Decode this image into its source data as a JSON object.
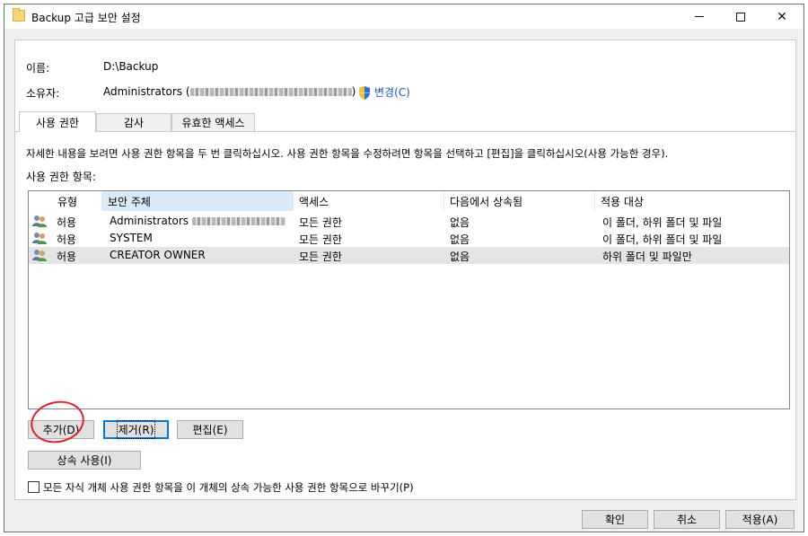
{
  "window": {
    "title": "Backup 고급 보안 설정"
  },
  "info": {
    "name_label": "이름:",
    "name_value": "D:\\Backup",
    "owner_label": "소유자:",
    "owner_value": "Administrators (",
    "owner_value_end": ")",
    "change_link": "변경(C)"
  },
  "tabs": [
    {
      "label": "사용 권한",
      "active": true
    },
    {
      "label": "감사",
      "active": false
    },
    {
      "label": "유효한 액세스",
      "active": false
    }
  ],
  "instructions": "자세한 내용을 보려면 사용 권한 항목을 두 번 클릭하십시오. 사용 권한 항목을 수정하려면 항목을 선택하고 [편집]을 클릭하십시오(사용 가능한 경우).",
  "entries_label": "사용 권한 항목:",
  "table": {
    "columns": [
      "유형",
      "보안 주체",
      "액세스",
      "다음에서 상속됨",
      "적용 대상"
    ],
    "rows": [
      {
        "type": "허용",
        "principal": "Administrators",
        "access": "모든 권한",
        "inherited": "없음",
        "applies": "이 폴더, 하위 폴더 및 파일"
      },
      {
        "type": "허용",
        "principal": "SYSTEM",
        "access": "모든 권한",
        "inherited": "없음",
        "applies": "이 폴더, 하위 폴더 및 파일"
      },
      {
        "type": "허용",
        "principal": "CREATOR OWNER",
        "access": "모든 권한",
        "inherited": "없음",
        "applies": "하위 폴더 및 파일만"
      }
    ]
  },
  "buttons": {
    "add": "추가(D)",
    "remove": "제거(R)",
    "edit": "편집(E)",
    "inheritance": "상속 사용(I)"
  },
  "replace_checkbox": "모든 자식 개체 사용 권한 항목을 이 개체의 상속 가능한 사용 권한 항목으로 바꾸기(P)",
  "footer": {
    "ok": "확인",
    "cancel": "취소",
    "apply": "적용(A)"
  },
  "colors": {
    "link": "#1a55c4",
    "selected_header": "#d9ebf9",
    "annotation": "#e0222b"
  },
  "icons": [
    "folder-icon",
    "minimize-icon",
    "maximize-icon",
    "close-icon",
    "uac-shield-icon",
    "user-group-icon"
  ]
}
